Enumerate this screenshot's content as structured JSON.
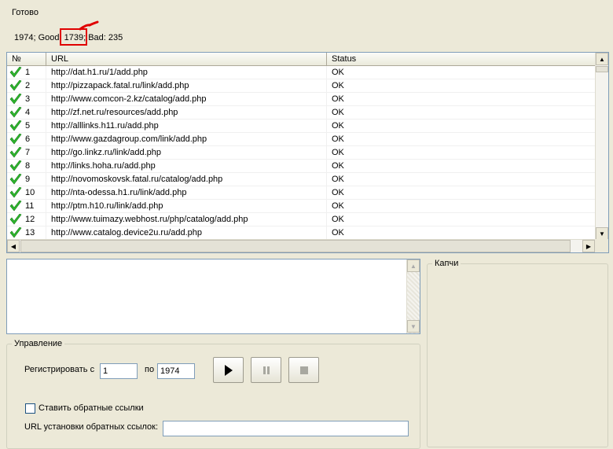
{
  "status": {
    "ready": "Готово",
    "stats_prefix": "1974; Good:",
    "stats_good": " 1739;",
    "stats_suffix": " Bad: 235"
  },
  "list": {
    "headers": {
      "num": "№",
      "url": "URL",
      "status": "Status"
    },
    "rows": [
      {
        "num": "1",
        "url": "http://dat.h1.ru/1/add.php",
        "status": "OK"
      },
      {
        "num": "2",
        "url": "http://pizzapack.fatal.ru/link/add.php",
        "status": "OK"
      },
      {
        "num": "3",
        "url": "http://www.comcon-2.kz/catalog/add.php",
        "status": "OK"
      },
      {
        "num": "4",
        "url": "http://zf.net.ru/resources/add.php",
        "status": "OK"
      },
      {
        "num": "5",
        "url": "http://alllinks.h11.ru/add.php",
        "status": "OK"
      },
      {
        "num": "6",
        "url": "http://www.gazdagroup.com/link/add.php",
        "status": "OK"
      },
      {
        "num": "7",
        "url": "http://go.linkz.ru/link/add.php",
        "status": "OK"
      },
      {
        "num": "8",
        "url": "http://links.hoha.ru/add.php",
        "status": "OK"
      },
      {
        "num": "9",
        "url": "http://novomoskovsk.fatal.ru/catalog/add.php",
        "status": "OK"
      },
      {
        "num": "10",
        "url": "http://nta-odessa.h1.ru/link/add.php",
        "status": "OK"
      },
      {
        "num": "11",
        "url": "http://ptm.h10.ru/link/add.php",
        "status": "OK"
      },
      {
        "num": "12",
        "url": "http://www.tuimazy.webhost.ru/php/catalog/add.php",
        "status": "OK"
      },
      {
        "num": "13",
        "url": "http://www.catalog.device2u.ru/add.php",
        "status": "OK"
      }
    ]
  },
  "captcha": {
    "legend": "Капчи"
  },
  "control": {
    "legend": "Управление",
    "register_from_label": "Регистрировать с",
    "from_value": "1",
    "to_label": "по",
    "to_value": "1974",
    "backlinks_checkbox_label": "Ставить обратные ссылки",
    "backlinks_checked": false,
    "backlinks_url_label": "URL установки обратных ссылок:",
    "backlinks_url_value": ""
  },
  "icons": {
    "row_status": "check-icon",
    "play": "play-icon",
    "pause": "pause-icon",
    "stop": "stop-icon"
  },
  "colors": {
    "check": "#2db82d",
    "highlight": "#e00000"
  }
}
